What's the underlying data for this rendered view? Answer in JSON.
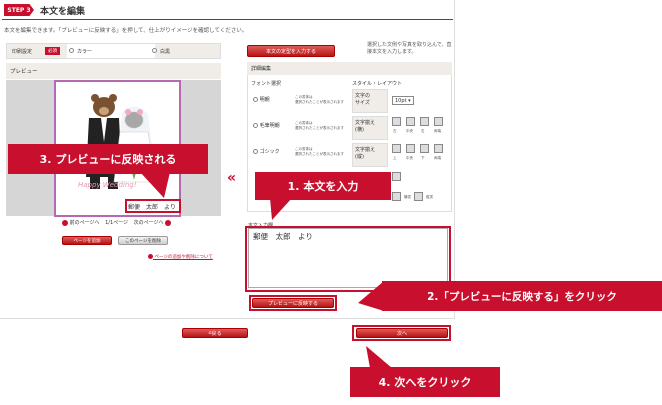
{
  "header": {
    "step_badge": "STEP 3",
    "title": "本文を編集"
  },
  "description": "本文を編集できます。「プレビューに反映する」を押して、仕上がりイメージを確認してください。",
  "print_options": {
    "label": "印刷設定",
    "required": "必須",
    "color_label": "カラー",
    "mono_label": "白黒"
  },
  "preview": {
    "heading": "プレビュー",
    "card_text": "Happy Wedding!",
    "card_names": "郵便　太郎　より"
  },
  "pager": {
    "prev": "前のページへ",
    "status": "1/1ページ",
    "next": "次のページへ"
  },
  "page_buttons": {
    "add": "ページを追加",
    "delete": "このページを削除"
  },
  "page_note_link": "ページの追加や削除について",
  "right_panel": {
    "template_button": "本文の定型を入力する",
    "guide": "選択した文例や写真を取り込んで、直接本文を入力します。",
    "detail_heading": "詳細編集",
    "font_heading": "フォント選択",
    "style_heading": "スタイル・レイアウト",
    "fonts": [
      {
        "name": "明朝",
        "sample": "この書体は\n選択されたことが表示されます"
      },
      {
        "name": "毛筆明朝",
        "sample": "この書体は\n選択されたことが表示されます"
      },
      {
        "name": "ゴシック",
        "sample": "この書体は\n選択されたことが表示されます"
      }
    ],
    "font_size_label": "文字の\nサイズ",
    "font_size_value": "10pt",
    "align_h_label": "文字揃え\n(横)",
    "align_h_options": [
      "左",
      "中央",
      "右",
      "両端"
    ],
    "align_v_label": "文字揃え\n(縦)",
    "align_v_options": [
      "上",
      "中央",
      "下",
      "両端"
    ],
    "direction_options": [
      "横書",
      "縦書"
    ]
  },
  "body_input": {
    "label": "本文入力欄",
    "value": "郵便　太郎　より"
  },
  "reflect_button": "プレビューに反映する",
  "nav": {
    "back": "戻る",
    "next": "次へ"
  },
  "callouts": {
    "c1": "1. 本文を入力",
    "c2": "2.「プレビューに反映する」をクリック",
    "c3": "3. プレビューに反映される",
    "c4": "4. 次へをクリック"
  },
  "colors": {
    "accent": "#c8102e",
    "panel": "#f0ece8"
  }
}
